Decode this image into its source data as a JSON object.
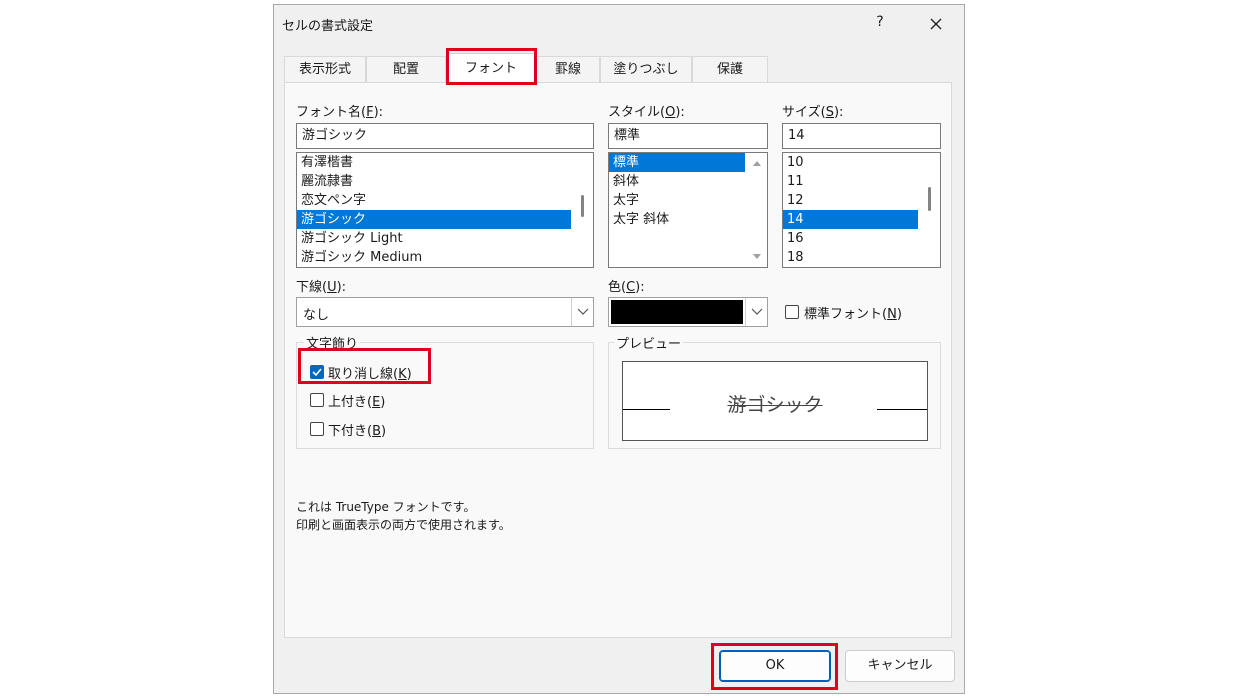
{
  "dialog": {
    "title": "セルの書式設定",
    "help_label": "?"
  },
  "tabs": [
    {
      "label": "表示形式"
    },
    {
      "label": "配置"
    },
    {
      "label": "フォント"
    },
    {
      "label": "罫線"
    },
    {
      "label": "塗りつぶし"
    },
    {
      "label": "保護"
    }
  ],
  "active_tab": "フォント",
  "font": {
    "label": "フォント名(",
    "key": "F",
    "label_end": "):",
    "value": "游ゴシック",
    "list": [
      "有澤楷書",
      "麗流隷書",
      "恋文ペン字",
      "游ゴシック",
      "游ゴシック Light",
      "游ゴシック Medium"
    ],
    "selected": "游ゴシック"
  },
  "style": {
    "label": "スタイル(",
    "key": "O",
    "label_end": "):",
    "value": "標準",
    "list": [
      "標準",
      "斜体",
      "太字",
      "太字 斜体"
    ],
    "selected": "標準"
  },
  "size": {
    "label": "サイズ(",
    "key": "S",
    "label_end": "):",
    "value": "14",
    "list": [
      "10",
      "11",
      "12",
      "14",
      "16",
      "18"
    ],
    "selected": "14"
  },
  "underline": {
    "label": "下線(",
    "key": "U",
    "label_end": "):",
    "value": "なし"
  },
  "color": {
    "label": "色(",
    "key": "C",
    "label_end": "):",
    "swatch": "#000000"
  },
  "normal_font": {
    "label": "標準フォント(",
    "key": "N",
    "label_end": ")",
    "checked": false
  },
  "effects": {
    "title": "文字飾り",
    "items": [
      {
        "label": "取り消し線(",
        "key": "K",
        "label_end": ")",
        "checked": true
      },
      {
        "label": "上付き(",
        "key": "E",
        "label_end": ")",
        "checked": false
      },
      {
        "label": "下付き(",
        "key": "B",
        "label_end": ")",
        "checked": false
      }
    ]
  },
  "preview": {
    "title": "プレビュー",
    "sample": "游ゴシック"
  },
  "info": {
    "line1": "これは TrueType フォントです。",
    "line2": "印刷と画面表示の両方で使用されます。"
  },
  "buttons": {
    "ok": "OK",
    "cancel": "キャンセル"
  },
  "colors": {
    "highlight": "#e0001b",
    "selection": "#0078d7",
    "checkbox_accent": "#0067c0"
  }
}
